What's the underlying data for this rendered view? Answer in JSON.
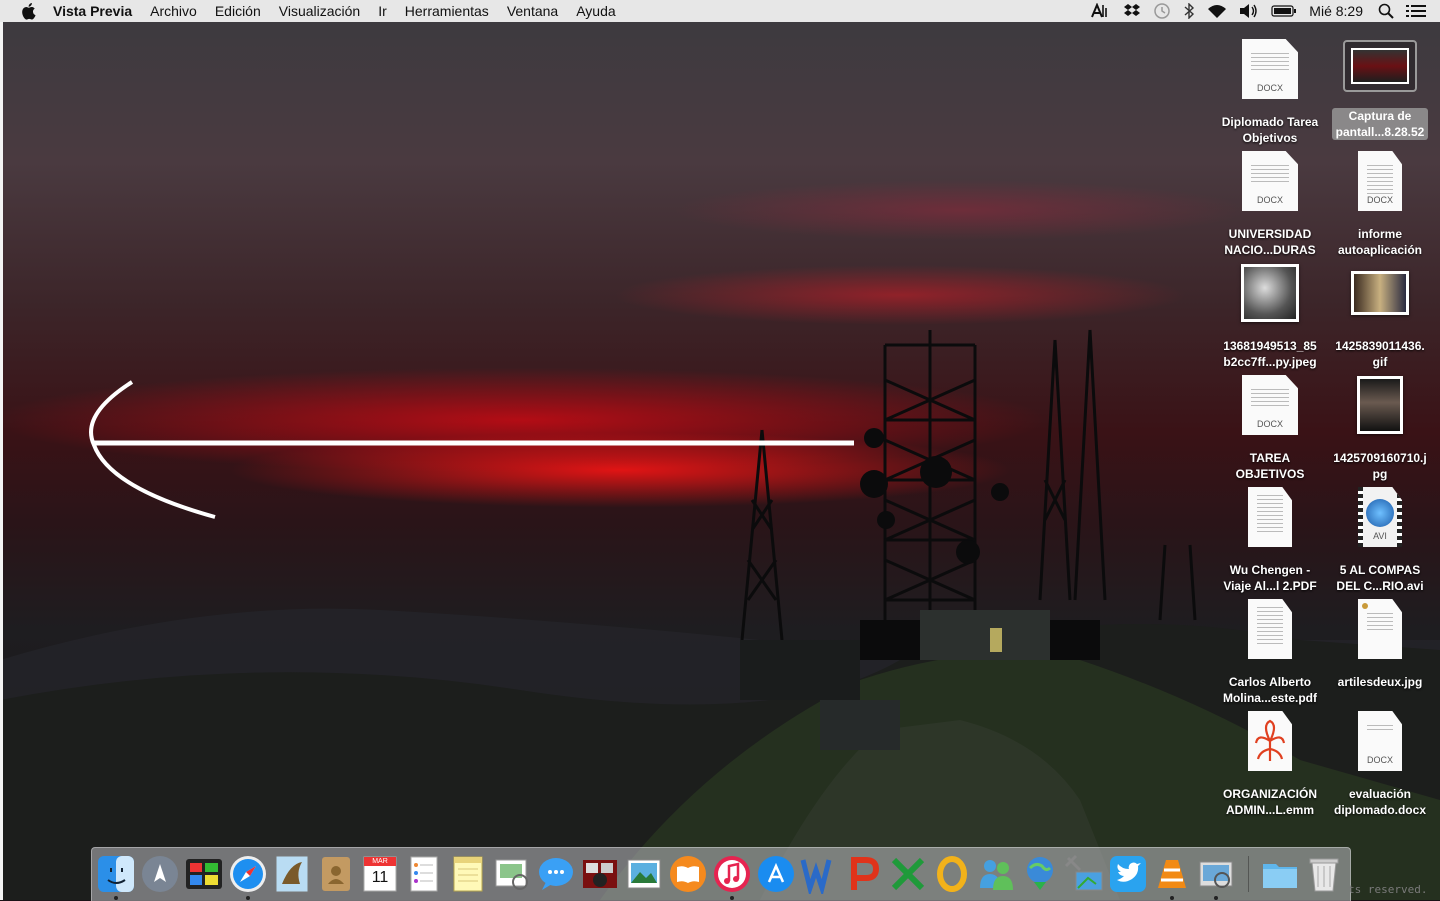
{
  "menubar": {
    "app_name": "Vista Previa",
    "items": [
      "Archivo",
      "Edición",
      "Visualización",
      "Ir",
      "Herramientas",
      "Ventana",
      "Ayuda"
    ],
    "clock": "Mié 8:29",
    "status_icons": [
      "adobe-icon",
      "dropbox-icon",
      "time-machine-icon",
      "bluetooth-icon",
      "wifi-icon",
      "volume-icon",
      "battery-icon",
      "spotlight-icon",
      "notification-center-icon"
    ]
  },
  "desktop": {
    "icons": [
      {
        "label": "Diplomado Tarea\nObjetivos",
        "kind": "docx",
        "badge": "DOCX"
      },
      {
        "label": "Captura de\npantall...8.28.52",
        "kind": "screenshot",
        "selected": true
      },
      {
        "label": "UNIVERSIDAD\nNACIO...DURAS",
        "kind": "docx",
        "badge": "DOCX"
      },
      {
        "label": "informe\nautoaplicación",
        "kind": "docx-page",
        "badge": "DOCX"
      },
      {
        "label": "13681949513_85\nb2cc7ff...py.jpeg",
        "kind": "image"
      },
      {
        "label": "1425839011436.\ngif",
        "kind": "image"
      },
      {
        "label": "TAREA\nOBJETIVOS",
        "kind": "docx",
        "badge": "DOCX"
      },
      {
        "label": "1425709160710.j\npg",
        "kind": "image"
      },
      {
        "label": "Wu Chengen -\nViaje Al...l 2.PDF",
        "kind": "pdf"
      },
      {
        "label": "5 AL COMPAS\nDEL C...RIO.avi",
        "kind": "avi",
        "badge": "AVI"
      },
      {
        "label": "Carlos Alberto\nMolina...este.pdf",
        "kind": "pdf"
      },
      {
        "label": "artilesdeux.jpg",
        "kind": "image-doc"
      },
      {
        "label": "ORGANIZACIÓN\nADMIN...L.emm",
        "kind": "emm"
      },
      {
        "label": "evaluación\ndiplomado.docx",
        "kind": "docx-page",
        "badge": "DOCX"
      }
    ]
  },
  "dock": {
    "apps": [
      "finder-icon",
      "launchpad-icon",
      "mission-control-icon",
      "safari-icon",
      "preview-eagle-icon",
      "contacts-icon",
      "calendar-icon",
      "reminders-icon",
      "notes-icon",
      "preview-icon",
      "messages-icon",
      "photo-booth-icon",
      "iphoto-icon",
      "ibooks-icon",
      "itunes-icon",
      "app-store-icon",
      "word-icon",
      "powerpoint-icon",
      "excel-icon",
      "outlook-icon",
      "messenger-icon",
      "downloader-globe-icon",
      "network-icon",
      "twitter-icon",
      "vlc-icon",
      "image-capture-icon",
      "downloads-folder-icon",
      "trash-icon"
    ],
    "calendar_month": "MAR",
    "calendar_day": "11",
    "running_dots": [
      "finder-icon",
      "safari-icon",
      "itunes-icon",
      "vlc-icon",
      "image-capture-icon"
    ]
  },
  "wallpaper_footer": "ts reserved.",
  "colors": {
    "menubar": "#ececec",
    "sky_red": "#e01418",
    "selection": "#969696"
  }
}
